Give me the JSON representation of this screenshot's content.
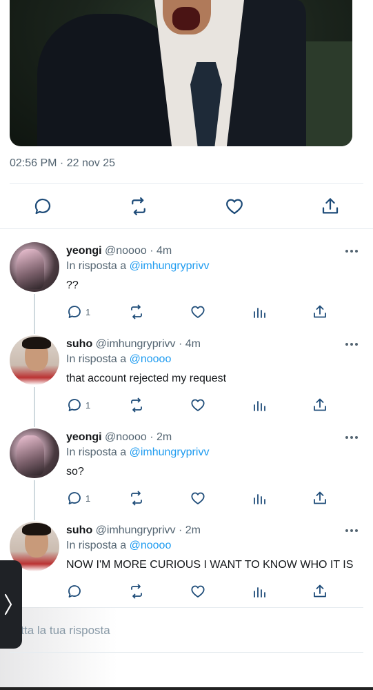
{
  "post": {
    "timestamp": "02:56 PM · 22 nov 25"
  },
  "tweets": [
    {
      "name": "yeongi",
      "handle": "@noooo · 4m",
      "reply_prefix": "In risposta a",
      "reply_to": "@imhungryprivv",
      "text": "??",
      "reply_count": "1"
    },
    {
      "name": "suho",
      "handle": "@imhungryprivv · 4m",
      "reply_prefix": "In risposta a",
      "reply_to": "@noooo",
      "text": "that account rejected my request",
      "reply_count": "1"
    },
    {
      "name": "yeongi",
      "handle": "@noooo · 2m",
      "reply_prefix": "In risposta a",
      "reply_to": "@imhungryprivv",
      "text": "so?",
      "reply_count": "1"
    },
    {
      "name": "suho",
      "handle": "@imhungryprivv · 2m",
      "reply_prefix": "In risposta a",
      "reply_to": "@noooo",
      "text": "NOW I'M MORE CURIOUS I WANT TO KNOW WHO IT IS",
      "reply_count": ""
    }
  ],
  "composer": {
    "placeholder": "vitta la tua risposta"
  },
  "colors": {
    "link": "#1d9bf0",
    "muted": "#536471",
    "icon": "#1d4b78"
  },
  "icons": [
    "comment-icon",
    "retweet-icon",
    "heart-icon",
    "share-icon",
    "stats-icon",
    "more-icon",
    "chevron-right-icon"
  ]
}
